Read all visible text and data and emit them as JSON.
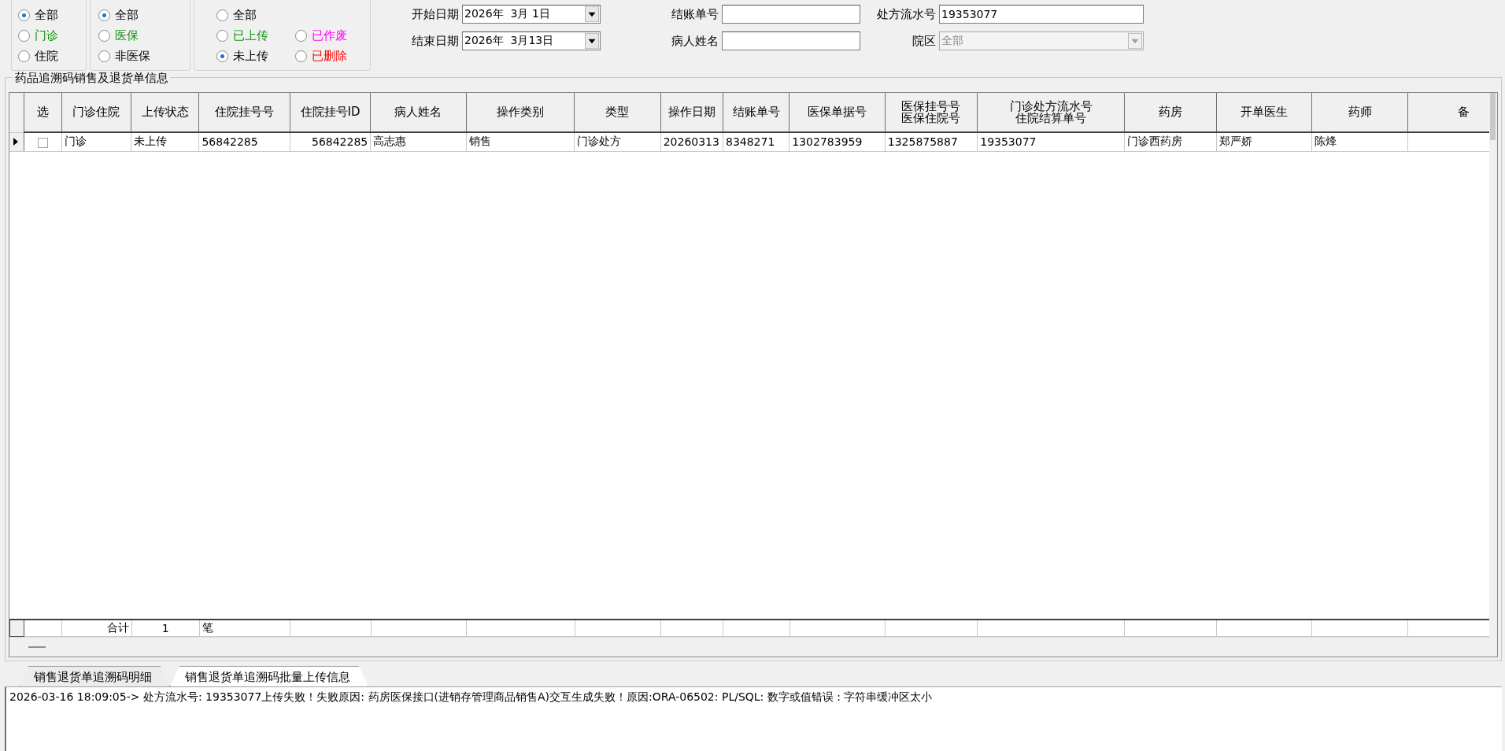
{
  "filters": [
    {
      "options": [
        {
          "label": "全部",
          "selected": true
        },
        {
          "label": "门诊",
          "selected": false,
          "color": "#109010"
        },
        {
          "label": "住院",
          "selected": false
        }
      ]
    },
    {
      "options": [
        {
          "label": "全部",
          "selected": true
        },
        {
          "label": "医保",
          "selected": false,
          "color": "#109010"
        },
        {
          "label": "非医保",
          "selected": false
        }
      ]
    },
    {
      "options": [
        {
          "label": "全部",
          "selected": false
        },
        {
          "label": "已上传",
          "selected": false,
          "color": "#109010"
        },
        {
          "label": "已作废",
          "selected": false,
          "color": "#ff00ff"
        },
        {
          "label": "未上传",
          "selected": true
        },
        {
          "label": "已删除",
          "selected": false,
          "color": "#ff0000"
        }
      ]
    }
  ],
  "form": [
    {
      "label": "开始日期",
      "kind": "date",
      "value": "2026年  3月 1日"
    },
    {
      "label": "结账单号",
      "kind": "text"
    },
    {
      "label": "处方流水号",
      "kind": "text",
      "value": "19353077"
    },
    {
      "label": "结束日期",
      "kind": "date",
      "value": "2026年  3月13日"
    },
    {
      "label": "病人姓名",
      "kind": "text"
    },
    {
      "label": "院区",
      "kind": "select",
      "value": "全部",
      "disabled": true
    }
  ],
  "table": {
    "title": "药品追溯码销售及退货单信息",
    "columns": [
      {
        "lines": [
          "选"
        ]
      },
      {
        "lines": [
          "门诊住院"
        ]
      },
      {
        "lines": [
          "上传状态"
        ]
      },
      {
        "lines": [
          "住院挂号号"
        ]
      },
      {
        "lines": [
          "住院挂号ID"
        ]
      },
      {
        "lines": [
          "病人姓名"
        ]
      },
      {
        "lines": [
          "操作类别"
        ]
      },
      {
        "lines": [
          "类型"
        ]
      },
      {
        "lines": [
          "操作日期"
        ]
      },
      {
        "lines": [
          "结账单号"
        ]
      },
      {
        "lines": [
          "医保单据号"
        ]
      },
      {
        "lines": [
          "医保挂号号",
          "医保住院号"
        ]
      },
      {
        "lines": [
          "门诊处方流水号",
          "住院结算单号"
        ]
      },
      {
        "lines": [
          "药房"
        ]
      },
      {
        "lines": [
          "开单医生"
        ]
      },
      {
        "lines": [
          "药师"
        ]
      },
      {
        "lines": [
          "备"
        ]
      }
    ],
    "rows": [
      {
        "selected": true,
        "cells": [
          {
            "checked": false
          },
          "门诊",
          "未上传",
          "56842285",
          "56842285",
          "高志惠",
          "销售",
          "门诊处方",
          "20260313",
          "8348271",
          "1302783959",
          "1325875887",
          "19353077",
          "门诊西药房",
          "郑严娇",
          "陈烽"
        ]
      }
    ],
    "summary": {
      "label": "合计",
      "count": "1",
      "unit": "笔"
    }
  },
  "tabs": [
    {
      "label": "销售退货单追溯码明细",
      "selected": false
    },
    {
      "label": "销售退货单追溯码批量上传信息",
      "selected": true
    }
  ],
  "log": [
    "2026-03-16 18:09:05-> 处方流水号: 19353077上传失败！失败原因: 药房医保接口(进销存管理商品销售A)交互生成失败！原因:ORA-06502: PL/SQL: 数字或值错误 : 字符串缓冲区太小"
  ]
}
